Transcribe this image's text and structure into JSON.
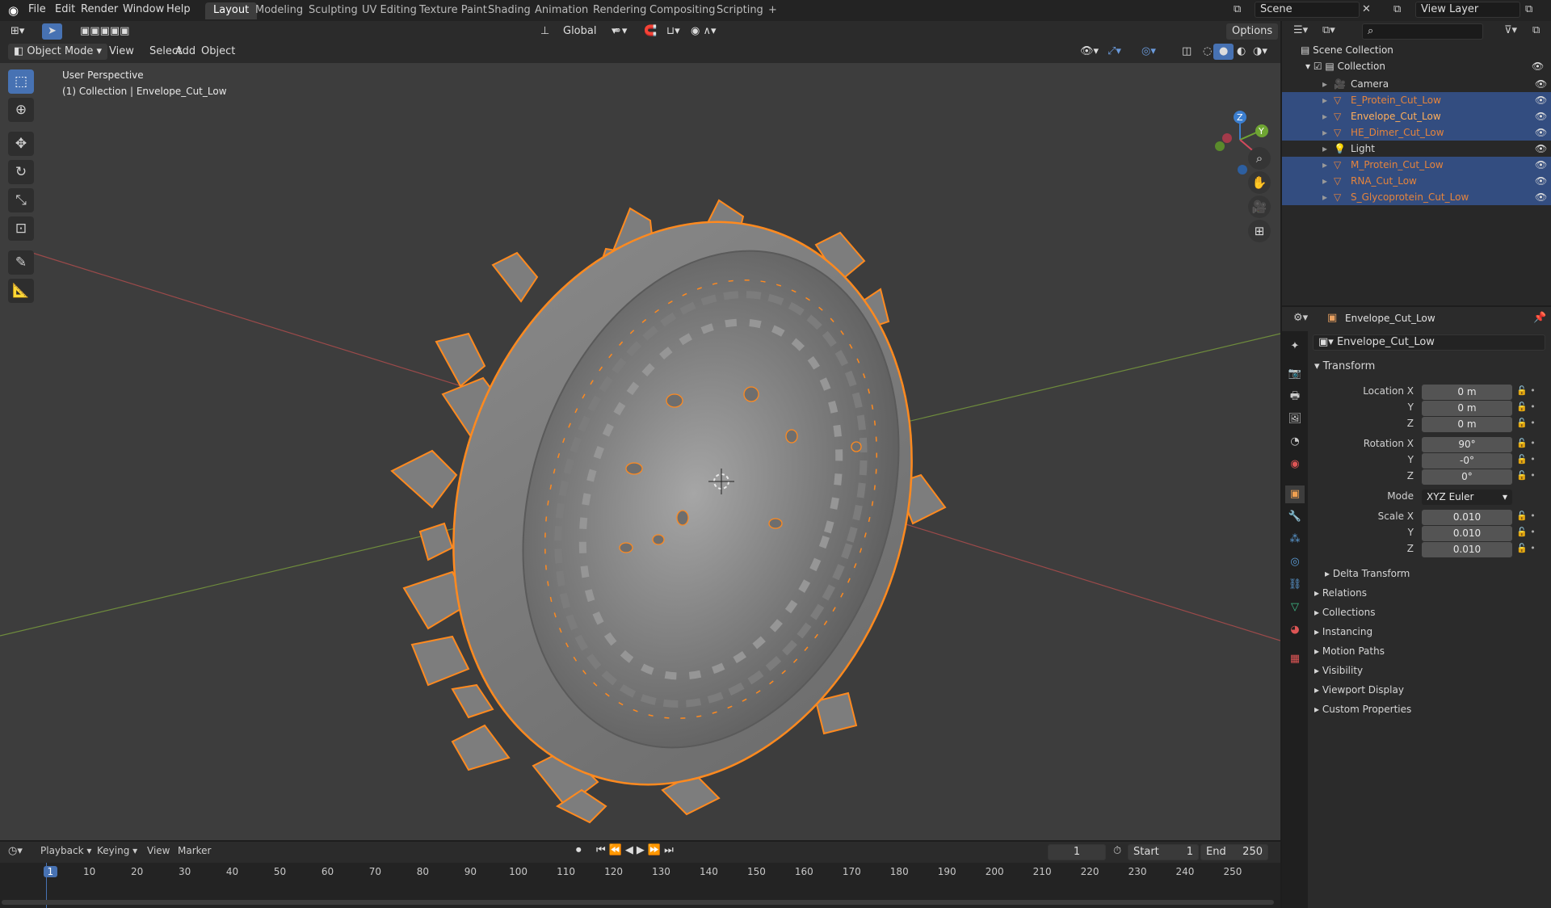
{
  "topbar": {
    "menus": [
      "File",
      "Edit",
      "Render",
      "Window",
      "Help"
    ],
    "workspaces": [
      "Layout",
      "Modeling",
      "Sculpting",
      "UV Editing",
      "Texture Paint",
      "Shading",
      "Animation",
      "Rendering",
      "Compositing",
      "Scripting"
    ],
    "active_workspace": "Layout",
    "add_tab": "+",
    "scene": "Scene",
    "view_layer": "View Layer"
  },
  "viewport_header": {
    "mode": "Object Mode",
    "menus": [
      "View",
      "Select",
      "Add",
      "Object"
    ],
    "orientation": "Global",
    "options": "Options"
  },
  "viewport": {
    "perspective": "User Perspective",
    "context": "(1) Collection | Envelope_Cut_Low",
    "gizmo": {
      "x": "X",
      "y": "Y",
      "z": "Z"
    }
  },
  "outliner": {
    "root": "Scene Collection",
    "collection": "Collection",
    "items": [
      {
        "label": "Camera",
        "selected": false,
        "color": "#d8d8d8"
      },
      {
        "label": "E_Protein_Cut_Low",
        "selected": true,
        "color": "#e5843c"
      },
      {
        "label": "Envelope_Cut_Low",
        "selected": true,
        "color": "#ffaf5a"
      },
      {
        "label": "HE_Dimer_Cut_Low",
        "selected": true,
        "color": "#e5843c"
      },
      {
        "label": "Light",
        "selected": false,
        "color": "#d8d8d8"
      },
      {
        "label": "M_Protein_Cut_Low",
        "selected": true,
        "color": "#e5843c"
      },
      {
        "label": "RNA_Cut_Low",
        "selected": true,
        "color": "#e5843c"
      },
      {
        "label": "S_Glycoprotein_Cut_Low",
        "selected": true,
        "color": "#e5843c"
      }
    ]
  },
  "properties": {
    "object_name": "Envelope_Cut_Low",
    "name_field": "Envelope_Cut_Low",
    "transform_title": "Transform",
    "location": {
      "label": "Location X",
      "x": "0 m",
      "y": "0 m",
      "z": "0 m"
    },
    "rotation": {
      "label": "Rotation X",
      "x": "90°",
      "y": "-0°",
      "z": "0°"
    },
    "mode": {
      "label": "Mode",
      "value": "XYZ Euler"
    },
    "scale": {
      "label": "Scale X",
      "x": "0.010",
      "y": "0.010",
      "z": "0.010"
    },
    "axis_labels": {
      "y": "Y",
      "z": "Z"
    },
    "delta": "Delta Transform",
    "panels": [
      "Relations",
      "Collections",
      "Instancing",
      "Motion Paths",
      "Visibility",
      "Viewport Display",
      "Custom Properties"
    ]
  },
  "timeline": {
    "menus": [
      "Playback",
      "Keying",
      "View",
      "Marker"
    ],
    "current_frame": "1",
    "start_label": "Start",
    "start": "1",
    "end_label": "End",
    "end": "250",
    "ticks": [
      "1",
      "10",
      "20",
      "30",
      "40",
      "50",
      "60",
      "70",
      "80",
      "90",
      "100",
      "110",
      "120",
      "130",
      "140",
      "150",
      "160",
      "170",
      "180",
      "190",
      "200",
      "210",
      "220",
      "230",
      "240",
      "250"
    ]
  },
  "colors": {
    "accent": "#4772b3",
    "selection_outline": "#ff8a1f",
    "active_object": "#ffaf5a"
  }
}
